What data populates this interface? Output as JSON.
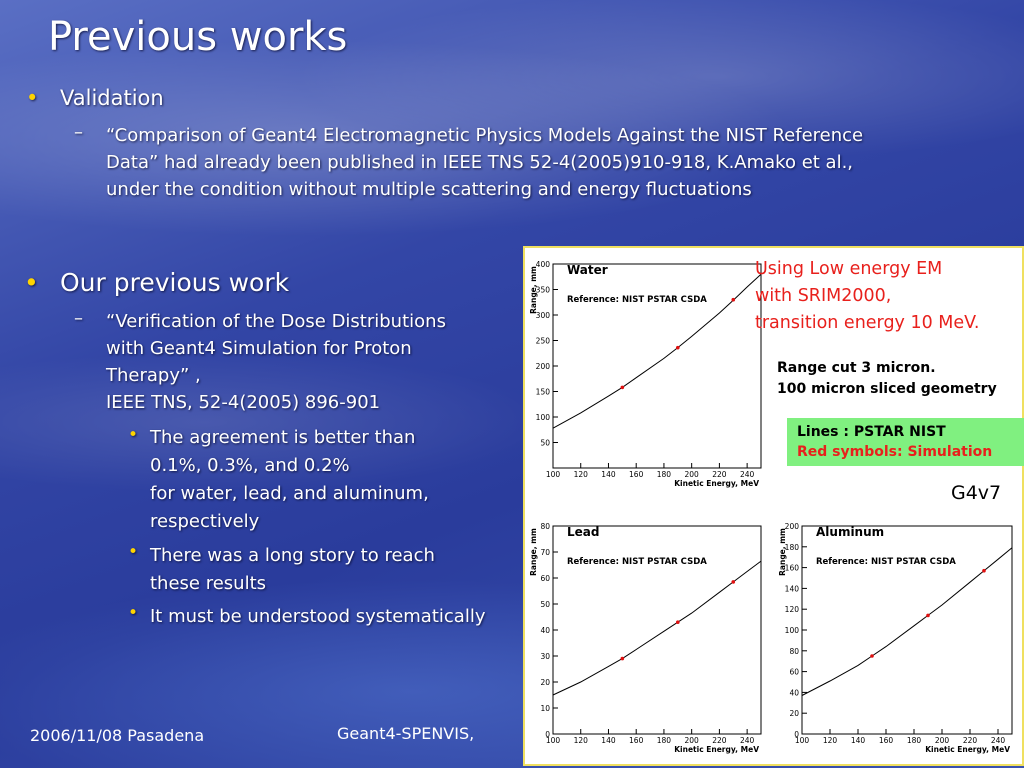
{
  "slide": {
    "title": "Previous works",
    "bullet1": "Validation",
    "bullet1_sub": "“Comparison of Geant4 Electromagnetic Physics Models Against the NIST Reference Data” had already been published in IEEE TNS 52-4(2005)910-918, K.Amako et al., under the condition without multiple scattering and energy fluctuations",
    "bullet2": "Our previous work",
    "bullet2_sub_lines": [
      "“Verification of the Dose Distributions",
      "with Geant4 Simulation for Proton",
      "Therapy” ,",
      "IEEE TNS, 52-4(2005) 896-901"
    ],
    "bullet3_1_lines": [
      " The agreement is better than",
      "0.1%, 0.3%, and 0.2%",
      "for water, lead, and aluminum,",
      " respectively"
    ],
    "bullet3_2_lines": [
      "There was a long story to reach",
      "these results"
    ],
    "bullet3_3": "It must be understood systematically",
    "annotation_red_lines": [
      "Using Low energy EM",
      "with SRIM2000,",
      "transition energy 10 MeV."
    ],
    "annotation_black_lines": [
      "Range cut 3 micron.",
      "100 micron sliced geometry"
    ],
    "legend_line1": "Lines :  PSTAR NIST",
    "legend_line2": "Red symbols: Simulation",
    "version": "G4v7",
    "footer_left": "2006/11/08 Pasadena",
    "footer_mid": "Geant4-SPENVIS,"
  },
  "colors": {
    "bullet": "#ffd400",
    "red_note": "#e8201c",
    "legend_bg": "#80f080",
    "simulation_marker": "#e01010"
  },
  "chart_data": [
    {
      "type": "line",
      "title": "Water",
      "subtitle": "Reference: NIST PSTAR CSDA",
      "xlabel": "Kinetic Energy, MeV",
      "ylabel": "Range, mm",
      "xlim": [
        100,
        250
      ],
      "ylim": [
        0,
        400
      ],
      "xticks": [
        100,
        120,
        140,
        160,
        180,
        200,
        220,
        240
      ],
      "yticks": [
        50,
        100,
        150,
        200,
        250,
        300,
        350,
        400
      ],
      "series": [
        {
          "x": [
            100,
            120,
            140,
            150,
            160,
            180,
            190,
            200,
            220,
            230,
            240,
            250
          ],
          "y": [
            78,
            108,
            141,
            158,
            177,
            215,
            236,
            258,
            304,
            329,
            355,
            380
          ]
        },
        {
          "x": [
            150,
            190,
            230
          ],
          "y": [
            158,
            236,
            330
          ]
        }
      ]
    },
    {
      "type": "line",
      "title": "Lead",
      "subtitle": "Reference: NIST PSTAR CSDA",
      "xlabel": "Kinetic Energy, MeV",
      "ylabel": "Range, mm",
      "xlim": [
        100,
        250
      ],
      "ylim": [
        0,
        80
      ],
      "xticks": [
        100,
        120,
        140,
        160,
        180,
        200,
        220,
        240
      ],
      "yticks": [
        0,
        10,
        20,
        30,
        40,
        50,
        60,
        70,
        80
      ],
      "series": [
        {
          "x": [
            100,
            120,
            140,
            150,
            160,
            180,
            190,
            200,
            220,
            230,
            240,
            250
          ],
          "y": [
            15,
            20,
            26,
            29,
            32.5,
            39.5,
            43,
            46.5,
            54.5,
            58.5,
            62.5,
            66.5
          ]
        },
        {
          "x": [
            150,
            190,
            230
          ],
          "y": [
            29,
            43,
            58.5
          ]
        }
      ]
    },
    {
      "type": "line",
      "title": "Aluminum",
      "subtitle": "Reference: NIST PSTAR CSDA",
      "xlabel": "Kinetic Energy, MeV",
      "ylabel": "Range, mm",
      "xlim": [
        100,
        250
      ],
      "ylim": [
        0,
        200
      ],
      "xticks": [
        100,
        120,
        140,
        160,
        180,
        200,
        220,
        240
      ],
      "yticks": [
        0,
        20,
        40,
        60,
        80,
        100,
        120,
        140,
        160,
        180,
        200
      ],
      "series": [
        {
          "x": [
            100,
            120,
            140,
            150,
            160,
            180,
            190,
            200,
            220,
            230,
            240,
            250
          ],
          "y": [
            37,
            51,
            66,
            75,
            84,
            104,
            114,
            124,
            146,
            157,
            168,
            179
          ]
        },
        {
          "x": [
            150,
            190,
            230
          ],
          "y": [
            75,
            114,
            157
          ]
        }
      ]
    }
  ]
}
